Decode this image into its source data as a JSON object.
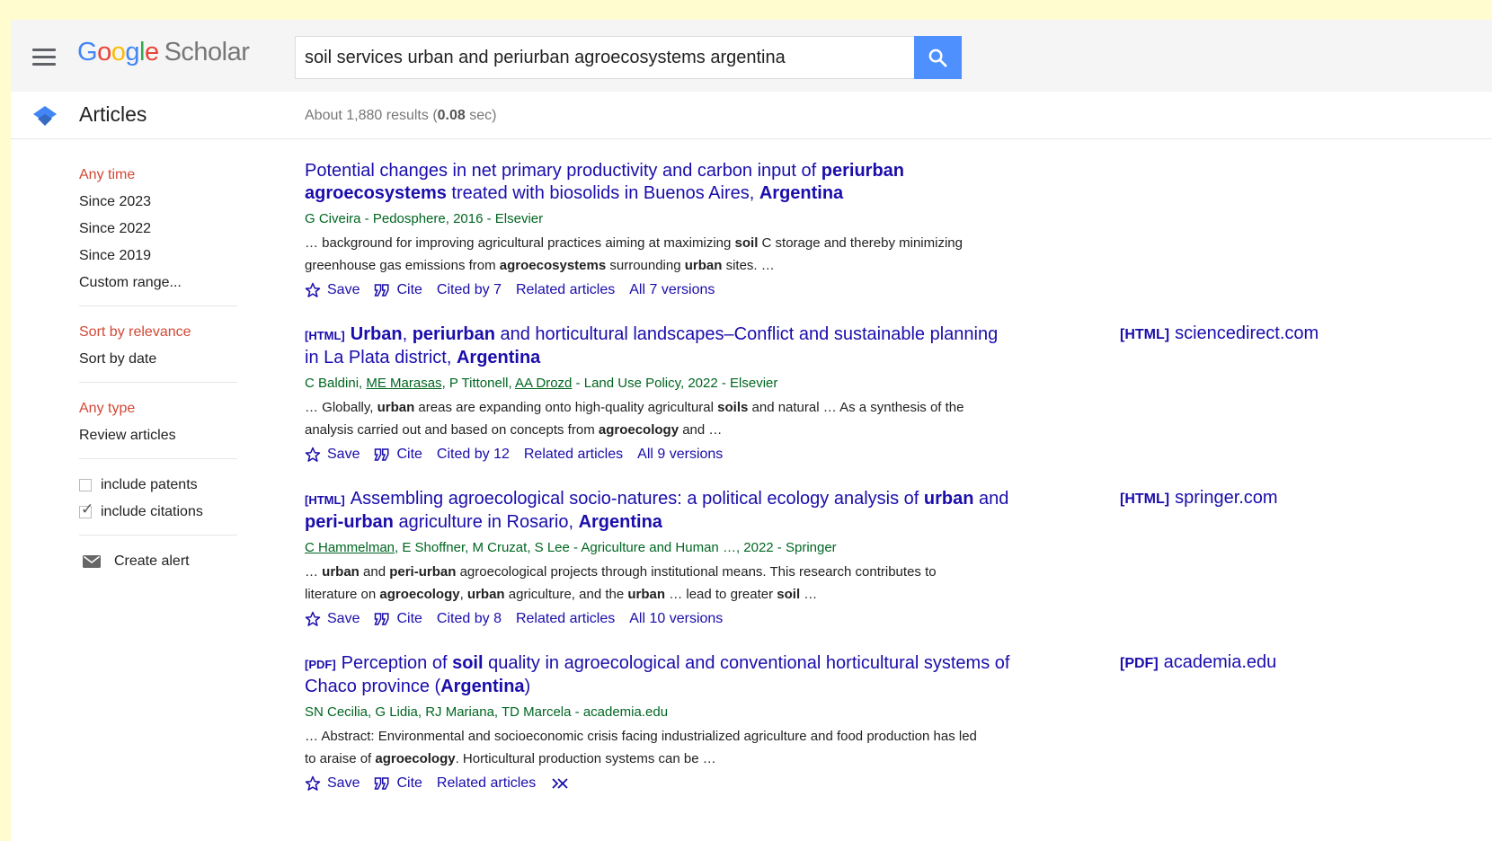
{
  "header": {
    "logo": {
      "g1": "G",
      "o1": "o",
      "o2": "o",
      "g2": "g",
      "l": "l",
      "e": "e",
      "scholar": "Scholar"
    },
    "search_value": "soil services urban and periurban agroecosystems argentina"
  },
  "subheader": {
    "section_title": "Articles",
    "stats_prefix": "About 1,880 results (",
    "stats_time": "0.08",
    "stats_suffix": " sec)"
  },
  "sidebar": {
    "time_filters": [
      "Any time",
      "Since 2023",
      "Since 2022",
      "Since 2019",
      "Custom range..."
    ],
    "sort_options": [
      "Sort by relevance",
      "Sort by date"
    ],
    "type_filters": [
      "Any type",
      "Review articles"
    ],
    "include_patents": "include patents",
    "include_citations": "include citations",
    "create_alert": "Create alert"
  },
  "results": [
    {
      "title": [
        {
          "t": "Potential changes in net primary productivity and carbon input of "
        },
        {
          "t": "periurban agroecosystems",
          "b": true
        },
        {
          "t": " treated with biosolids in Buenos Aires, "
        },
        {
          "t": "Argentina",
          "b": true
        }
      ],
      "authors": [
        {
          "t": "G Civeira - Pedosphere, 2016 - Elsevier"
        }
      ],
      "snippet": [
        {
          "t": "… background for improving agricultural practices aiming at maximizing "
        },
        {
          "t": "soil",
          "b": true
        },
        {
          "t": " C storage and thereby minimizing greenhouse gas emissions from "
        },
        {
          "t": "agroecosystems",
          "b": true
        },
        {
          "t": " surrounding "
        },
        {
          "t": "urban",
          "b": true
        },
        {
          "t": " sites. …"
        }
      ],
      "actions": [
        "Save",
        "Cite",
        "Cited by 7",
        "Related articles",
        "All 7 versions"
      ]
    },
    {
      "type": "[HTML]",
      "title": [
        {
          "t": "Urban",
          "b": true
        },
        {
          "t": ", "
        },
        {
          "t": "periurban",
          "b": true
        },
        {
          "t": " and horticultural landscapes–Conflict and sustainable planning in La Plata district, "
        },
        {
          "t": "Argentina",
          "b": true
        }
      ],
      "authors": [
        {
          "t": "C Baldini, "
        },
        {
          "t": "ME Marasas",
          "u": true
        },
        {
          "t": ", P Tittonell, "
        },
        {
          "t": "AA Drozd",
          "u": true
        },
        {
          "t": " - Land Use Policy, 2022 - Elsevier"
        }
      ],
      "snippet": [
        {
          "t": "… Globally, "
        },
        {
          "t": "urban",
          "b": true
        },
        {
          "t": " areas are expanding onto high-quality agricultural "
        },
        {
          "t": "soils",
          "b": true
        },
        {
          "t": " and natural … As a synthesis of the analysis carried out and based on concepts from "
        },
        {
          "t": "agroecology",
          "b": true
        },
        {
          "t": " and …"
        }
      ],
      "actions": [
        "Save",
        "Cite",
        "Cited by 12",
        "Related articles",
        "All 9 versions"
      ],
      "side_type": "[HTML]",
      "side_site": "sciencedirect.com"
    },
    {
      "type": "[HTML]",
      "title": [
        {
          "t": "Assembling agroecological socio-natures: a political ecology analysis of "
        },
        {
          "t": "urban",
          "b": true
        },
        {
          "t": " and "
        },
        {
          "t": "peri-urban",
          "b": true
        },
        {
          "t": " agriculture in Rosario, "
        },
        {
          "t": "Argentina",
          "b": true
        }
      ],
      "authors": [
        {
          "t": "C Hammelman",
          "u": true
        },
        {
          "t": ", E Shoffner, M Cruzat, S Lee - Agriculture and Human …, 2022 - Springer"
        }
      ],
      "snippet": [
        {
          "t": "… "
        },
        {
          "t": "urban",
          "b": true
        },
        {
          "t": " and "
        },
        {
          "t": "peri-urban",
          "b": true
        },
        {
          "t": " agroecological projects through institutional means. This research contributes to literature on "
        },
        {
          "t": "agroecology",
          "b": true
        },
        {
          "t": ", "
        },
        {
          "t": "urban",
          "b": true
        },
        {
          "t": " agriculture, and the "
        },
        {
          "t": "urban",
          "b": true
        },
        {
          "t": " … lead to greater "
        },
        {
          "t": "soil",
          "b": true
        },
        {
          "t": " …"
        }
      ],
      "actions": [
        "Save",
        "Cite",
        "Cited by 8",
        "Related articles",
        "All 10 versions"
      ],
      "side_type": "[HTML]",
      "side_site": "springer.com"
    },
    {
      "type": "[PDF]",
      "title": [
        {
          "t": "Perception of "
        },
        {
          "t": "soil",
          "b": true
        },
        {
          "t": " quality in agroecological and conventional horticultural systems of Chaco province ("
        },
        {
          "t": "Argentina",
          "b": true
        },
        {
          "t": ")"
        }
      ],
      "authors": [
        {
          "t": "SN Cecilia, G Lidia, RJ Mariana, TD Marcela - academia.edu"
        }
      ],
      "snippet": [
        {
          "t": "… Abstract: Environmental and socioeconomic crisis facing industrialized agriculture and food production has led to araise of "
        },
        {
          "t": "agroecology",
          "b": true
        },
        {
          "t": ". Horticultural production systems can be …"
        }
      ],
      "actions": [
        "Save",
        "Cite",
        "Related articles"
      ],
      "side_type": "[PDF]",
      "side_site": "academia.edu"
    }
  ]
}
